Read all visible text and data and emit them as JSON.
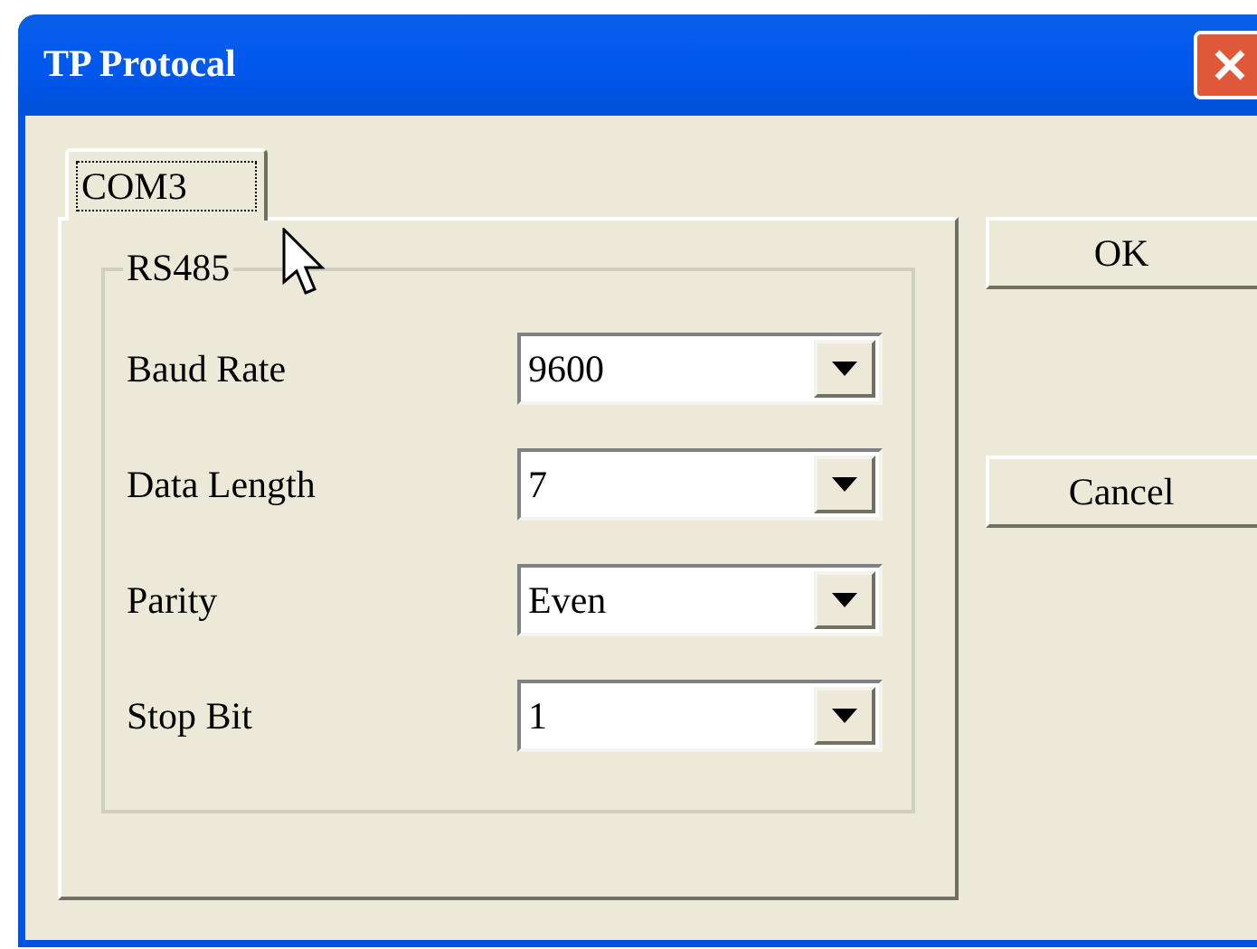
{
  "window": {
    "title": "TP Protocal"
  },
  "tabs": [
    {
      "label": "COM3",
      "selected": true
    }
  ],
  "group": {
    "title": "RS485",
    "fields": [
      {
        "label": "Baud Rate",
        "value": "9600"
      },
      {
        "label": "Data Length",
        "value": "7"
      },
      {
        "label": "Parity",
        "value": "Even"
      },
      {
        "label": "Stop Bit",
        "value": "1"
      }
    ]
  },
  "buttons": [
    "OK",
    "Cancel"
  ]
}
